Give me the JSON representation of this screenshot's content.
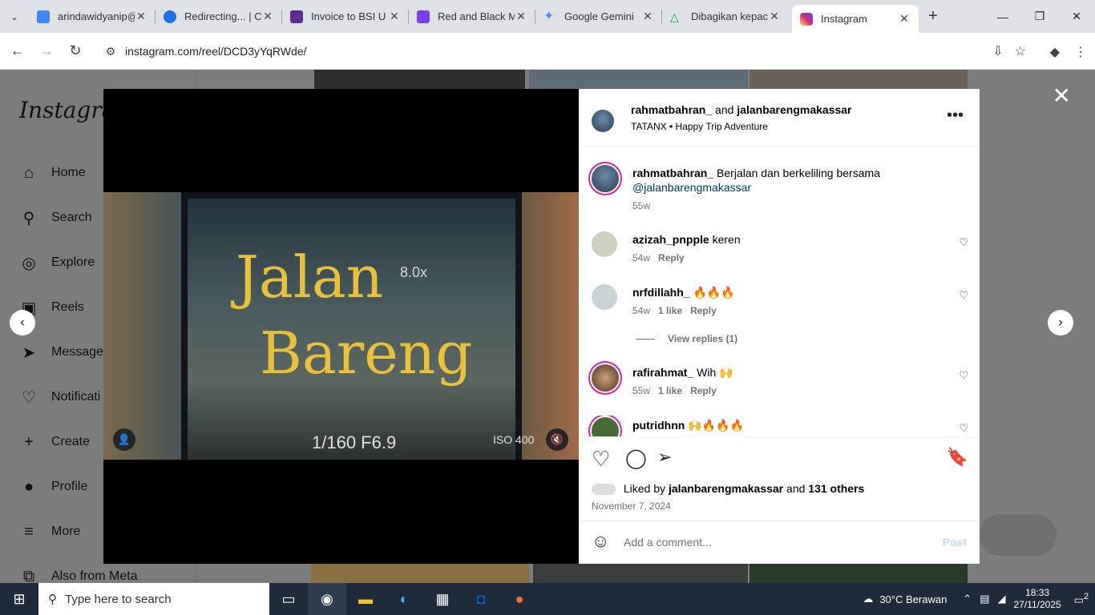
{
  "tabs": [
    {
      "title": "arindawidyanip@",
      "favicon_color": "#4285f4",
      "icon": "docs-icon"
    },
    {
      "title": "Redirecting... | C",
      "favicon_color": "#1a73e8",
      "icon": "c-icon"
    },
    {
      "title": "Invoice to BSI U",
      "favicon_color": "#5c2d91",
      "icon": "printer-icon"
    },
    {
      "title": "Red and Black M",
      "favicon_color": "#7b3ff2",
      "icon": "canva-icon"
    },
    {
      "title": "Google Gemini",
      "favicon_color": "#4a8cff",
      "icon": "gemini-icon"
    },
    {
      "title": "Dibagikan kepac",
      "favicon_color": "#0f9d58",
      "icon": "drive-icon"
    },
    {
      "title": "Instagram",
      "favicon_color": "#e1306c",
      "icon": "instagram-icon",
      "active": true
    }
  ],
  "url": "instagram.com/reel/DCD3yYqRWde/",
  "sidebar": {
    "logo": "Instagram",
    "items": [
      {
        "label": "Home",
        "icon": "home-icon"
      },
      {
        "label": "Search",
        "icon": "search-icon"
      },
      {
        "label": "Explore",
        "icon": "compass-icon"
      },
      {
        "label": "Reels",
        "icon": "reels-icon"
      },
      {
        "label": "Messages",
        "icon": "messenger-icon"
      },
      {
        "label": "Notificati",
        "icon": "heart-icon"
      },
      {
        "label": "Create",
        "icon": "plus-icon"
      },
      {
        "label": "Profile",
        "icon": "avatar-icon"
      },
      {
        "label": "More",
        "icon": "menu-icon"
      },
      {
        "label": "Also from Meta",
        "icon": "meta-icon"
      }
    ]
  },
  "video": {
    "line1": "Jalan",
    "line2": "Bareng",
    "zoom": "8.0x",
    "exif": "1/160  F6.9",
    "iso": "ISO 400"
  },
  "post": {
    "author": "rahmatbahran_",
    "and": "and",
    "collaborator": "jalanbarengmakassar",
    "audio": "TATANX • Happy Trip Adventure",
    "caption_user": "rahmatbahran_",
    "caption": "Berjalan dan berkeliling bersama",
    "caption_mention": "@jalanbarengmakassar",
    "caption_age": "55w"
  },
  "comments": [
    {
      "user": "azizah_pnpple",
      "text": "keren",
      "age": "54w",
      "likes": "",
      "reply": "Reply"
    },
    {
      "user": "nrfdillahh_",
      "text": "🔥🔥🔥",
      "age": "54w",
      "likes": "1 like",
      "reply": "Reply"
    },
    {
      "user": "rafirahmat_",
      "text": "Wih 🙌",
      "age": "55w",
      "likes": "1 like",
      "reply": "Reply"
    },
    {
      "user": "putridhnn",
      "text": "🙌🔥🔥🔥",
      "age": "",
      "likes": "",
      "reply": ""
    }
  ],
  "view_replies": "View replies (1)",
  "liked_by_prefix": "Liked by",
  "liked_by_user": "jalanbarengmakassar",
  "liked_by_and": "and",
  "liked_by_others": "131 others",
  "post_date": "November 7, 2024",
  "add_comment_placeholder": "Add a comment...",
  "post_button": "Post",
  "taskbar": {
    "search_placeholder": "Type here to search",
    "weather": "30°C Berawan",
    "time": "18:33",
    "date": "27/11/2025",
    "notif_count": "2"
  }
}
